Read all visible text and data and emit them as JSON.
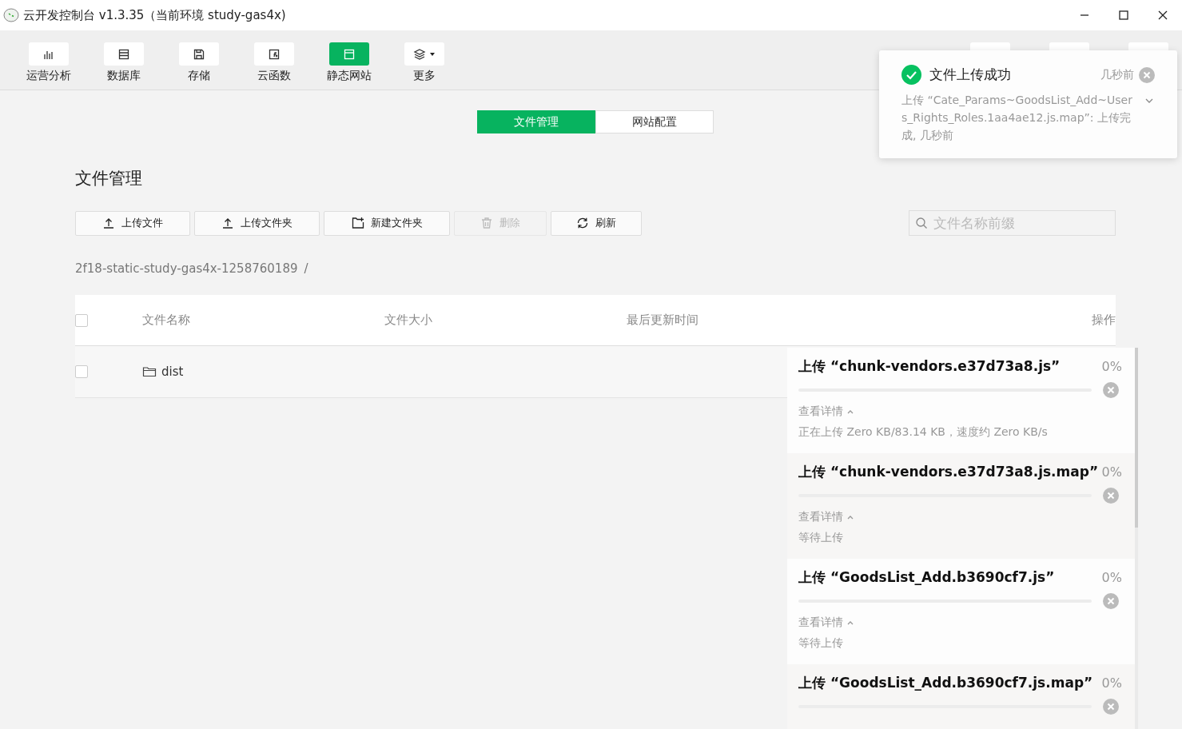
{
  "window": {
    "title": "云开发控制台 v1.3.35（当前环境 study-gas4x)"
  },
  "toolbar": [
    {
      "label": "运营分析",
      "selected": false
    },
    {
      "label": "数据库",
      "selected": false
    },
    {
      "label": "存储",
      "selected": false
    },
    {
      "label": "云函数",
      "selected": false
    },
    {
      "label": "静态网站",
      "selected": true
    },
    {
      "label": "更多",
      "selected": false
    }
  ],
  "tabs": [
    {
      "label": "文件管理",
      "selected": true
    },
    {
      "label": "网站配置",
      "selected": false
    }
  ],
  "heading": "文件管理",
  "actions": [
    {
      "label": "上传文件",
      "disabled": false
    },
    {
      "label": "上传文件夹",
      "disabled": false
    },
    {
      "label": "新建文件夹",
      "disabled": false
    },
    {
      "label": "删除",
      "disabled": true
    },
    {
      "label": "刷新",
      "disabled": false
    }
  ],
  "search": {
    "placeholder": "文件名称前缀"
  },
  "breadcrumb": {
    "path": "2f18-static-study-gas4x-1258760189",
    "separator": "/"
  },
  "table": {
    "header_checked": false,
    "columns": [
      "文件名称",
      "文件大小",
      "最后更新时间",
      "操作"
    ],
    "rows": [
      {
        "name": "dist",
        "checked": false
      }
    ]
  },
  "toast": {
    "title": "文件上传成功",
    "time": "几秒前",
    "message": "上传 “Cate_Params~GoodsList_Add~Users_Rights_Roles.1aa4ae12.js.map”: 上传完成, 几秒前"
  },
  "uploads": [
    {
      "title": "上传 “chunk-vendors.e37d73a8.js”",
      "percent": "0%",
      "level": 0,
      "details": "查看详情",
      "status": "正在上传 Zero KB/83.14 KB，速度约 Zero KB/s"
    },
    {
      "title": "上传 “chunk-vendors.e37d73a8.js.map”",
      "percent": "0%",
      "level": 0,
      "details": "查看详情",
      "status": "等待上传"
    },
    {
      "title": "上传 “GoodsList_Add.b3690cf7.js”",
      "percent": "0%",
      "level": 0,
      "details": "查看详情",
      "status": "等待上传"
    },
    {
      "title": "上传 “GoodsList_Add.b3690cf7.js.map”",
      "percent": "0%",
      "level": 0
    }
  ]
}
